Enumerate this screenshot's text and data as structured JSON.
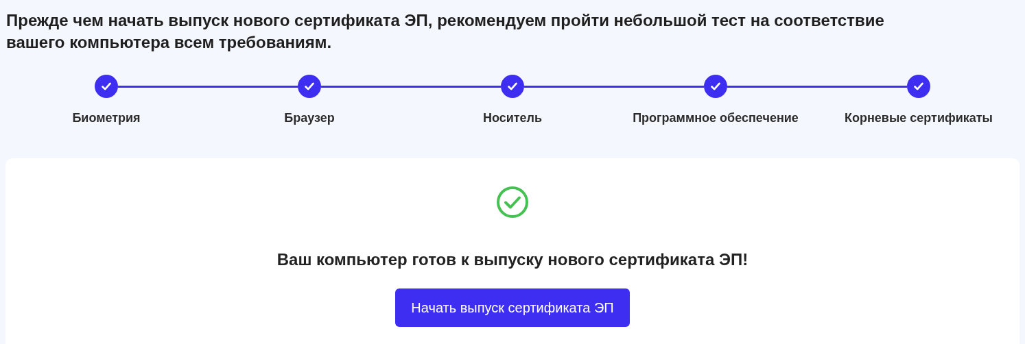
{
  "heading": "Прежде чем начать выпуск нового сертификата ЭП, рекомендуем пройти небольшой тест на соответствие вашего компьютера всем требованиям.",
  "steps": [
    {
      "label": "Биометрия",
      "completed": true
    },
    {
      "label": "Браузер",
      "completed": true
    },
    {
      "label": "Носитель",
      "completed": true
    },
    {
      "label": "Программное обеспечение",
      "completed": true
    },
    {
      "label": "Корневые сертификаты",
      "completed": true
    }
  ],
  "result": {
    "success": true,
    "message": "Ваш компьютер готов к выпуску нового сертификата ЭП!",
    "button": "Начать выпуск сертификата ЭП"
  }
}
